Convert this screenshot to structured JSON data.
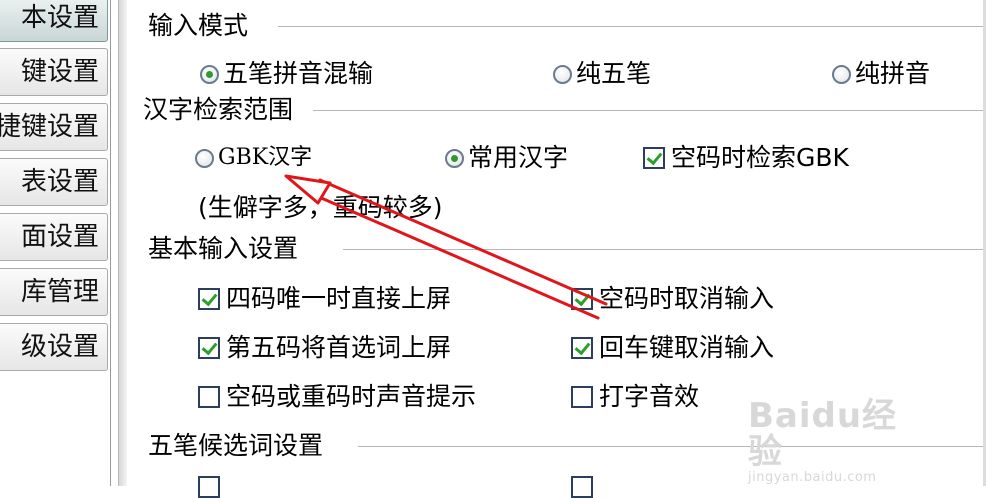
{
  "sidebar": {
    "items": [
      {
        "label": "本设置",
        "active": true
      },
      {
        "label": "键设置",
        "active": false
      },
      {
        "label": "捷键设置",
        "active": false
      },
      {
        "label": "表设置",
        "active": false
      },
      {
        "label": "面设置",
        "active": false
      },
      {
        "label": "库管理",
        "active": false
      },
      {
        "label": "级设置",
        "active": false
      }
    ]
  },
  "input_mode": {
    "title": "输入模式",
    "options": [
      {
        "label": "五笔拼音混输",
        "selected": true
      },
      {
        "label": "纯五笔",
        "selected": false
      },
      {
        "label": "纯拼音",
        "selected": false
      }
    ]
  },
  "search_range": {
    "title": "汉字检索范围",
    "options": [
      {
        "label": "GBK汉字",
        "selected": false
      },
      {
        "label": "常用汉字",
        "selected": true
      }
    ],
    "gbk_checkbox": {
      "label": "空码时检索GBK",
      "checked": true
    },
    "note": "(生僻字多，重码较多)"
  },
  "basic_input": {
    "title": "基本输入设置",
    "checks": [
      {
        "label": "四码唯一时直接上屏",
        "checked": true
      },
      {
        "label": "空码时取消输入",
        "checked": true
      },
      {
        "label": "第五码将首选词上屏",
        "checked": true
      },
      {
        "label": "回车键取消输入",
        "checked": true
      },
      {
        "label": "空码或重码时声音提示",
        "checked": false
      },
      {
        "label": "打字音效",
        "checked": false
      }
    ]
  },
  "candidate": {
    "title": "五笔候选词设置"
  },
  "colors": {
    "accent_check": "#2aa02a",
    "annotation_arrow": "#e0161b"
  },
  "watermark": {
    "logo": "Baidu经验",
    "url": "jingyan.baidu.com"
  }
}
